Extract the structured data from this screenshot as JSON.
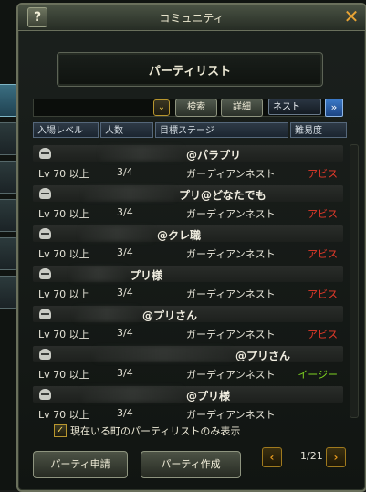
{
  "window": {
    "title": "コミュニティ",
    "help": "?",
    "close": "✕"
  },
  "heading": "パーティリスト",
  "toolbar": {
    "search": "検索",
    "detail": "詳細",
    "nest": "ネスト",
    "nest_arrow": "»",
    "dropdown": "⌄"
  },
  "columns": [
    "入場レベル",
    "人数",
    "目標ステージ",
    "難易度"
  ],
  "rows": [
    {
      "name": "@パラプリ",
      "level": "Lv 70 以上",
      "count": "3/4",
      "stage": "ガーディアンネスト",
      "difficulty": "アビス",
      "diff_color": "#e83a2a"
    },
    {
      "name": "プリ@どなたでも",
      "level": "Lv 70 以上",
      "count": "3/4",
      "stage": "ガーディアンネスト",
      "difficulty": "アビス",
      "diff_color": "#e83a2a"
    },
    {
      "name": "@クレ職",
      "level": "Lv 70 以上",
      "count": "3/4",
      "stage": "ガーディアンネスト",
      "difficulty": "アビス",
      "diff_color": "#e83a2a"
    },
    {
      "name": "プリ様",
      "level": "Lv 70 以上",
      "count": "3/4",
      "stage": "ガーディアンネスト",
      "difficulty": "アビス",
      "diff_color": "#e83a2a"
    },
    {
      "name": "@プリさん",
      "level": "Lv 70 以上",
      "count": "3/4",
      "stage": "ガーディアンネスト",
      "difficulty": "アビス",
      "diff_color": "#e83a2a"
    },
    {
      "name": "@プリさん",
      "level": "Lv 70 以上",
      "count": "3/4",
      "stage": "ガーディアンネスト",
      "difficulty": "イージー",
      "diff_color": "#7ed321"
    },
    {
      "name": "@プリ様",
      "level": "Lv 70 以上",
      "count": "3/4",
      "stage": "ガーディアンネスト",
      "difficulty": "",
      "diff_color": "#e83a2a"
    }
  ],
  "checkbox": {
    "label": "現在いる町のパーティリストのみ表示",
    "checked": true,
    "mark": "✓"
  },
  "buttons": {
    "apply": "パーティ申請",
    "create": "パーティ作成"
  },
  "pager": {
    "prev": "‹",
    "next": "›",
    "page": "1/21"
  },
  "colors": {
    "frame": "#6a705c",
    "pager": "#e59a1e"
  }
}
